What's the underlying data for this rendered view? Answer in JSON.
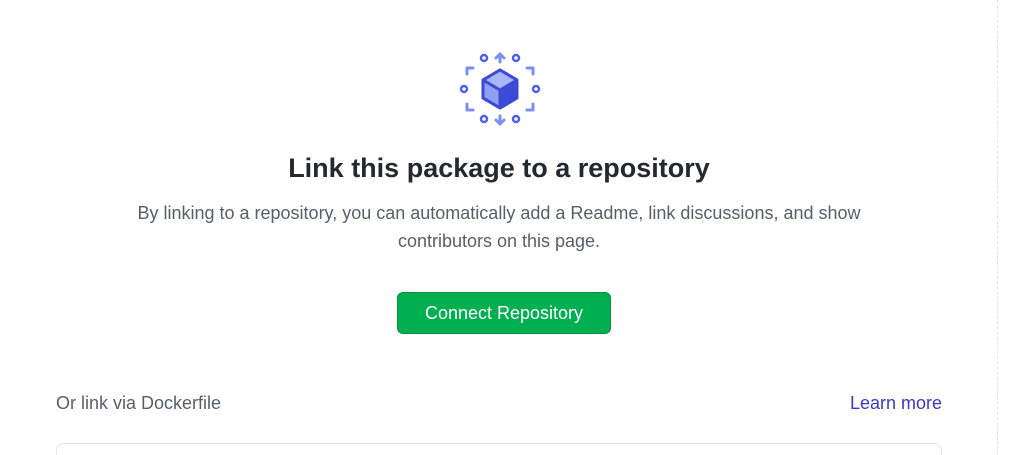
{
  "hero": {
    "icon": "package-hub-icon",
    "icon_colors": {
      "primary": "#5b6cf0",
      "light": "#8ea0f5",
      "dark": "#3d4ad6"
    }
  },
  "title": "Link this package to a repository",
  "description": "By linking to a repository, you can automatically add a Readme, link discussions, and show contributors on this page.",
  "connect_button": {
    "label": "Connect Repository",
    "color": "#00b050"
  },
  "dockerfile": {
    "label": "Or link via Dockerfile",
    "learn_more": "Learn more",
    "link_color": "#3b38c6"
  }
}
